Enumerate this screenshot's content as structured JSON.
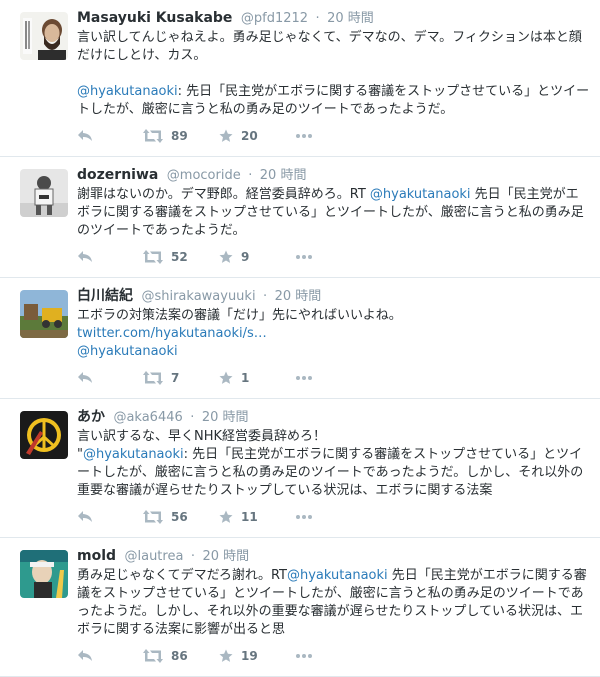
{
  "tweets": [
    {
      "name": "Masayuki Kusakabe",
      "screen_name": "@pfd1212",
      "separator": "·",
      "time": "20 時間",
      "parts": [
        {
          "t": "言い訳してんじゃねえよ。勇み足じゃなくて、デマなの、デマ。フィクションは本と顔だけにしとけ、カス。\n\n",
          "link": false
        },
        {
          "t": "@hyakutanaoki",
          "link": true
        },
        {
          "t": ": 先日「民主党がエボラに関する審議をストップさせている」とツイートしたが、厳密に言うと私の勇み足のツイートであったようだ。",
          "link": false
        }
      ],
      "retweets": "89",
      "favorites": "20"
    },
    {
      "name": "dozerniwa",
      "screen_name": "@mocoride",
      "separator": "·",
      "time": "20 時間",
      "parts": [
        {
          "t": "謝罪はないのか。デマ野郎。経営委員辞めろ。RT ",
          "link": false
        },
        {
          "t": "@hyakutanaoki",
          "link": true
        },
        {
          "t": " 先日「民主党がエボラに関する審議をストップさせている」とツイートしたが、厳密に言うと私の勇み足のツイートであったようだ。",
          "link": false
        }
      ],
      "retweets": "52",
      "favorites": "9"
    },
    {
      "name": "白川結紀",
      "screen_name": "@shirakawayuuki",
      "separator": "·",
      "time": "20 時間",
      "parts": [
        {
          "t": "エボラの対策法案の審議「だけ」先にやればいいよね。\n",
          "link": false
        },
        {
          "t": "twitter.com/hyakutanaoki/s…",
          "link": true
        },
        {
          "t": "\n",
          "link": false
        },
        {
          "t": "@hyakutanaoki",
          "link": true
        }
      ],
      "retweets": "7",
      "favorites": "1"
    },
    {
      "name": "あか",
      "screen_name": "@aka6446",
      "separator": "·",
      "time": "20 時間",
      "parts": [
        {
          "t": "言い訳するな、早くNHK経営委員辞めろ！\n\"",
          "link": false
        },
        {
          "t": "@hyakutanaoki",
          "link": true
        },
        {
          "t": ": 先日「民主党がエボラに関する審議をストップさせている」とツイートしたが、厳密に言うと私の勇み足のツイートであったようだ。しかし、それ以外の重要な審議が遅らせたりストップしている状況は、エボラに関する法案",
          "link": false
        }
      ],
      "retweets": "56",
      "favorites": "11"
    },
    {
      "name": "mold",
      "screen_name": "@lautrea",
      "separator": "·",
      "time": "20 時間",
      "parts": [
        {
          "t": "勇み足じゃなくてデマだろ謝れ。RT",
          "link": false
        },
        {
          "t": "@hyakutanaoki",
          "link": true
        },
        {
          "t": " 先日「民主党がエボラに関する審議をストップさせている」とツイートしたが、厳密に言うと私の勇み足のツイートであったようだ。しかし、それ以外の重要な審議が遅らせたりストップしている状況は、エボラに関する法案に影響が出ると思",
          "link": false
        }
      ],
      "retweets": "86",
      "favorites": "19"
    }
  ],
  "colors": {
    "link": "#2b7bb9",
    "meta": "#8899a6",
    "text": "#292f33",
    "divider": "#e1e8ed"
  },
  "icons": {
    "reply": "reply-icon",
    "retweet": "retweet-icon",
    "favorite": "star-icon",
    "more": "more-dots-icon"
  }
}
